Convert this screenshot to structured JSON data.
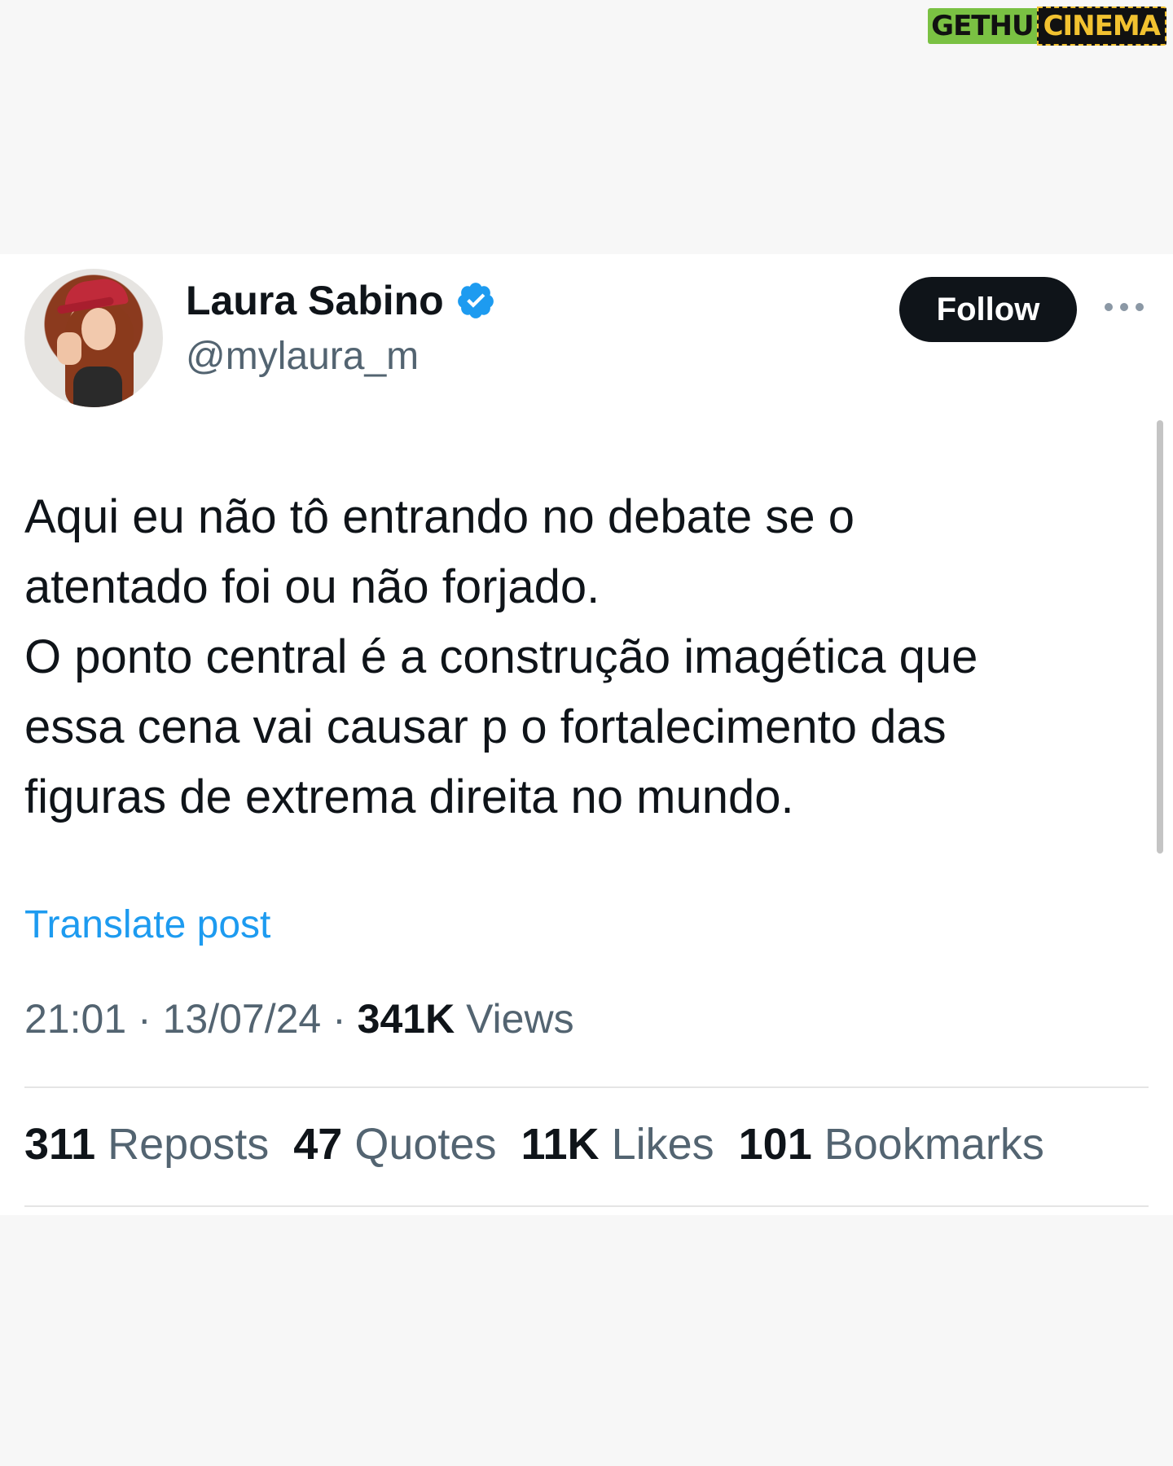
{
  "watermark": {
    "left": "GETHU",
    "right": "CINEMA"
  },
  "profile": {
    "display_name": "Laura Sabino",
    "handle": "@mylaura_m",
    "verified_icon": "verified-badge-icon"
  },
  "follow_label": "Follow",
  "more_icon": "more-options-icon",
  "post": {
    "text": "Aqui eu não tô entrando no debate se o\natentado foi ou não forjado.\nO ponto central é a construção imagética que\nessa cena vai causar p o fortalecimento das\nfiguras de extrema direita no mundo.",
    "translate_label": "Translate post",
    "time": "21:01",
    "date": "13/07/24",
    "views_count": "341K",
    "views_label": "Views"
  },
  "stats": [
    {
      "count": "311",
      "label": "Reposts"
    },
    {
      "count": "47",
      "label": "Quotes"
    },
    {
      "count": "11K",
      "label": "Likes"
    },
    {
      "count": "101",
      "label": "Bookmarks"
    }
  ],
  "colors": {
    "accent": "#1d9bf0",
    "text_primary": "#0f1419",
    "text_secondary": "#536471",
    "follow_bg": "#0f1419"
  }
}
